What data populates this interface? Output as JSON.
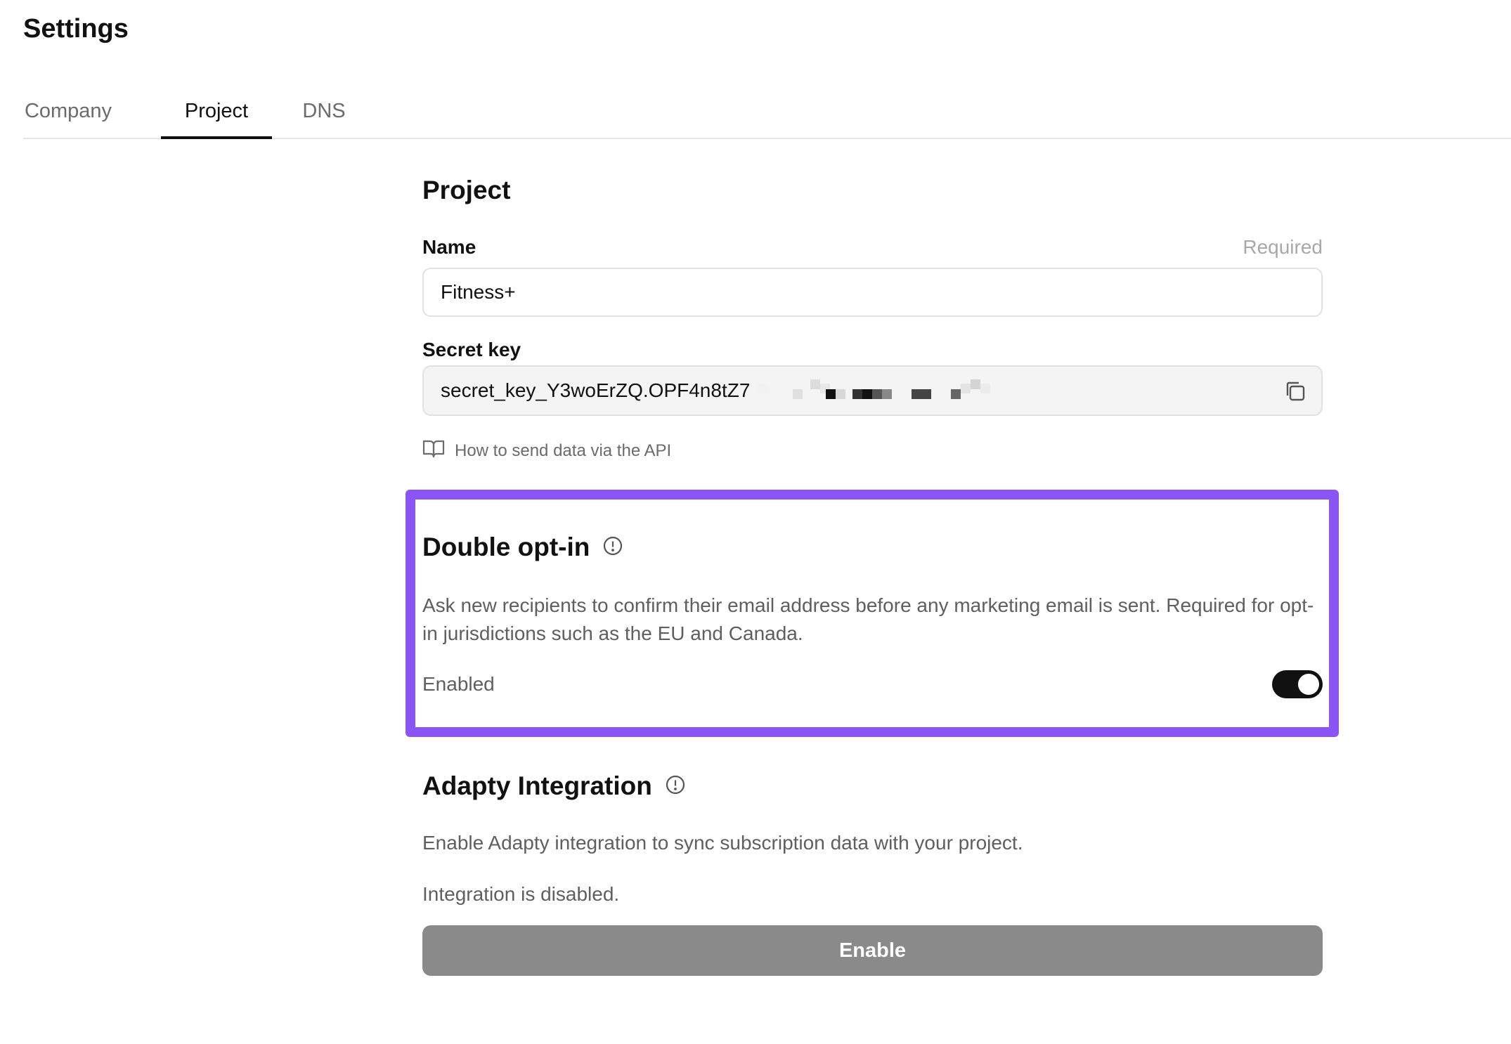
{
  "header": {
    "title": "Settings"
  },
  "tabs": [
    {
      "label": "Company",
      "active": false
    },
    {
      "label": "Project",
      "active": true
    },
    {
      "label": "DNS",
      "active": false
    }
  ],
  "project": {
    "section_title": "Project",
    "name_label": "Name",
    "name_required": "Required",
    "name_value": "Fitness+",
    "secret_label": "Secret key",
    "secret_value": "secret_key_Y3woErZQ.OPF4n8tZ7",
    "doc_link": "How to send data via the API"
  },
  "double_opt_in": {
    "title": "Double opt-in",
    "description": "Ask new recipients to confirm their email address before any marketing email is sent. Required for opt-in jurisdictions such as the EU and Canada.",
    "status_label": "Enabled",
    "toggle_on": true,
    "highlight_color": "#8b55f6"
  },
  "adapty": {
    "title": "Adapty Integration",
    "description": "Enable Adapty integration to sync subscription data with your project.",
    "status": "Integration is disabled.",
    "button_label": "Enable",
    "button_color": "#8a8a8a"
  }
}
